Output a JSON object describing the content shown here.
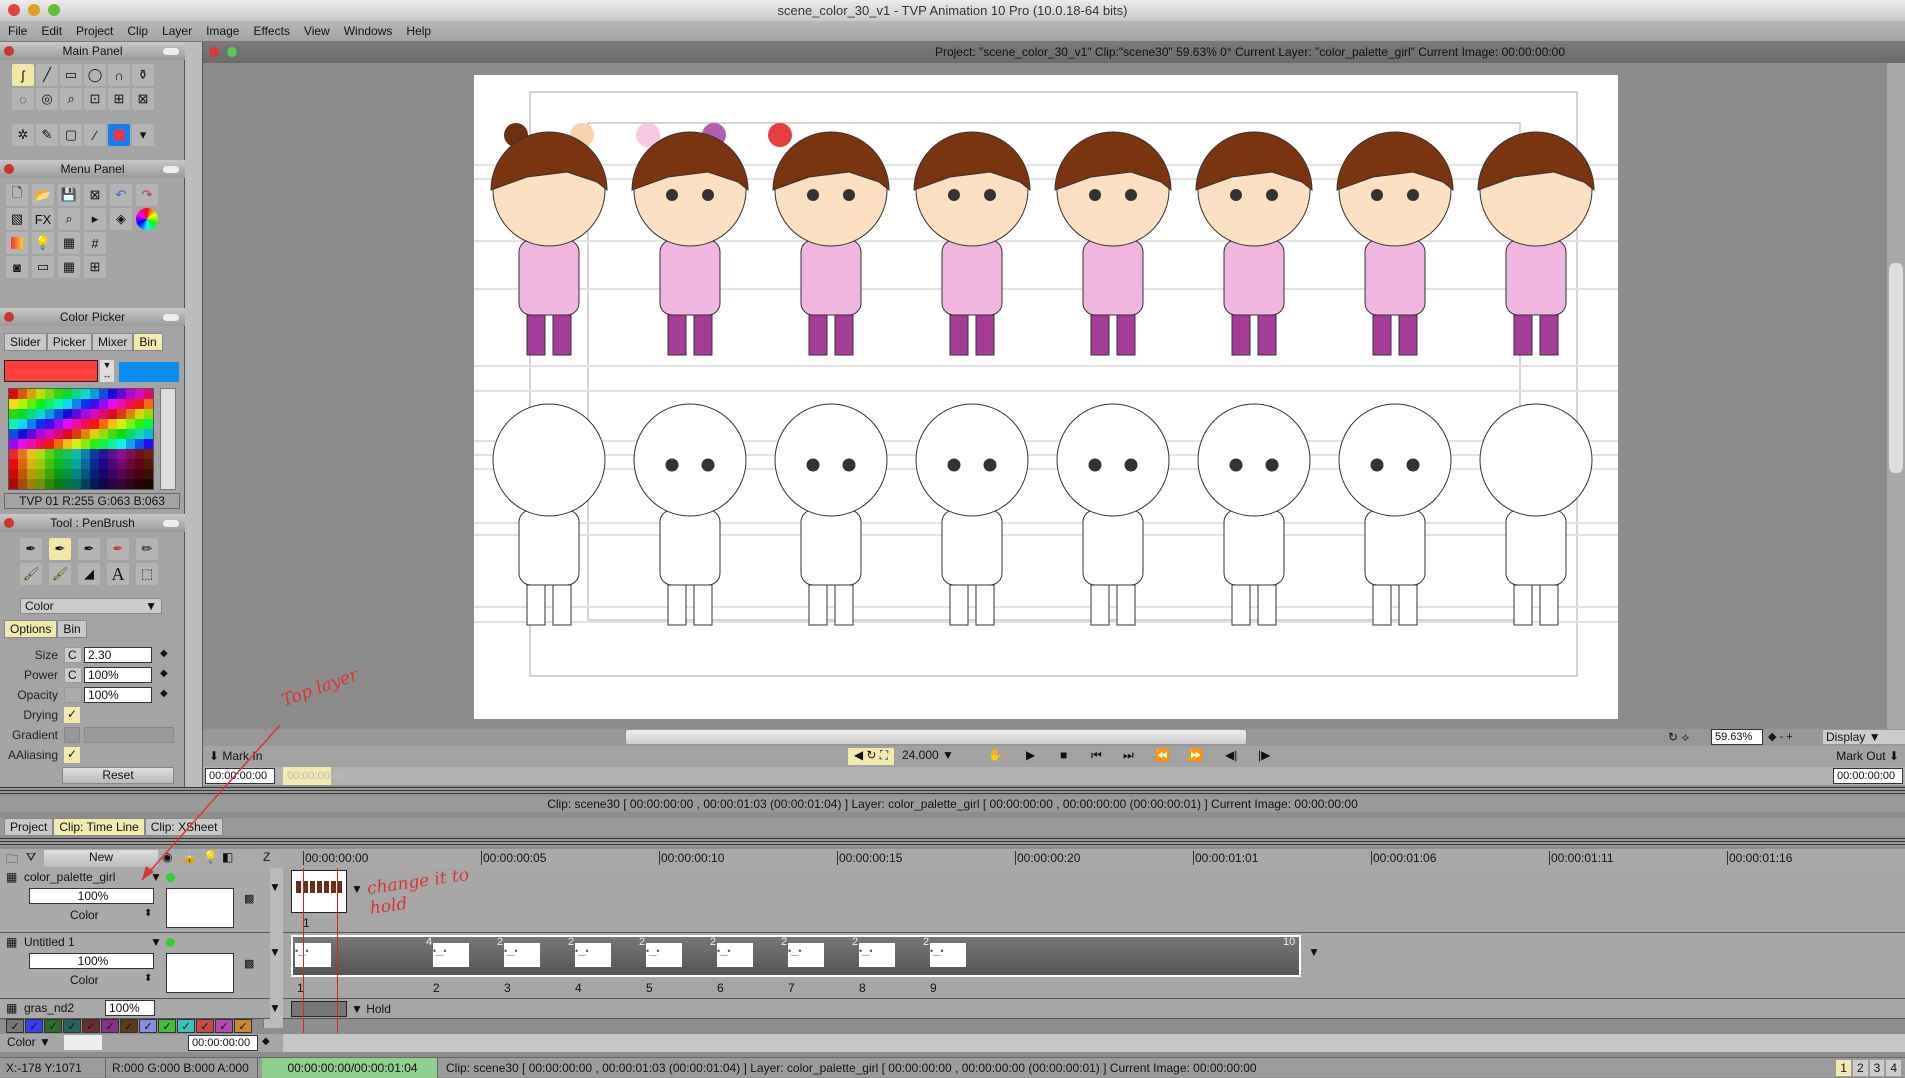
{
  "window": {
    "title": "scene_color_30_v1 - TVP Animation 10 Pro (10.0.18-64 bits)"
  },
  "menu": [
    "File",
    "Edit",
    "Project",
    "Clip",
    "Layer",
    "Image",
    "Effects",
    "View",
    "Windows",
    "Help"
  ],
  "main_panel": {
    "title": "Main Panel"
  },
  "menu_panel": {
    "title": "Menu Panel",
    "fx_label": "FX"
  },
  "color_picker": {
    "title": "Color Picker",
    "tabs": [
      "Slider",
      "Picker",
      "Mixer",
      "Bin"
    ],
    "active_tab": "Bin",
    "primary_color": "#ff3f3f",
    "secondary_color": "#0a8cf0",
    "info": "TVP 01 R:255 G:063 B:063"
  },
  "tool": {
    "title": "Tool : PenBrush",
    "mode": "Color",
    "tabs": [
      "Options",
      "Bin"
    ],
    "size_label": "Size",
    "size": "2.30",
    "power_label": "Power",
    "power": "100%",
    "opacity_label": "Opacity",
    "opacity": "100%",
    "drying_label": "Drying",
    "gradient_label": "Gradient",
    "aaliasing_label": "AAliasing",
    "c": "C",
    "reset": "Reset",
    "text_tool": "A"
  },
  "view": {
    "info": "Project: \"scene_color_30_v1\" Clip:\"scene30\"  59.63%   0°  Current Layer: \"color_palette_girl\"  Current Image: 00:00:00:00",
    "palette_swatches": [
      "#6b2f12",
      "#f9d3ad",
      "#f6c8e2",
      "#b35cb0",
      "#e83d3d"
    ]
  },
  "playback": {
    "mark_in": "Mark In",
    "mark_out": "Mark Out",
    "fps": "24.000",
    "zoom": "59.63%",
    "display": "Display",
    "start_tc": "00:00:00:00",
    "cursor_tc": "00:00:00:00",
    "end_tc": "00:00:00:00"
  },
  "clip_info": "Clip: scene30 [ 00:00:00:00 , 00:00:01:03  (00:00:01:04) ]     Layer: color_palette_girl [ 00:00:00:00 , 00:00:00:00  (00:00:00:01) ]   Current Image: 00:00:00:00",
  "bottom_tabs": [
    "Project",
    "Clip: Time Line",
    "Clip: XSheet"
  ],
  "timeline": {
    "new_button": "New",
    "z": "Z",
    "ruler": [
      "00:00:00:00",
      "00:00:00:05",
      "00:00:00:10",
      "00:00:00:15",
      "00:00:00:20",
      "00:00:01:01",
      "00:00:01:06",
      "00:00:01:11",
      "00:00:01:16"
    ],
    "layers": [
      {
        "name": "color_palette_girl",
        "opacity": "100%",
        "mode": "Color",
        "frames": [
          "1"
        ]
      },
      {
        "name": "Untitled 1",
        "opacity": "100%",
        "mode": "Color",
        "frames": [
          "1",
          "2",
          "3",
          "4",
          "5",
          "6",
          "7",
          "8",
          "9"
        ],
        "holds": [
          "4",
          "2",
          "2",
          "2",
          "2",
          "2",
          "2",
          "2",
          "10"
        ]
      },
      {
        "name": "gras_nd2",
        "opacity": "100%",
        "hold": "Hold"
      }
    ],
    "color_tags": [
      "#777777",
      "#3b3bf0",
      "#2f6a2f",
      "#2f6060",
      "#6a2d2d",
      "#8a2f8a",
      "#5a3a1a",
      "#8a8ae0",
      "#3fbf3f",
      "#3fbfbf",
      "#c84a4a",
      "#b04ab0",
      "#c8883a"
    ],
    "mode": "Color",
    "timecode": "00:00:00:00"
  },
  "annotations": {
    "top_layer": "Top layer",
    "change_hold": "change it to hold"
  },
  "status": {
    "coords": "X:-178  Y:1071",
    "rgba": "R:000 G:000 B:000 A:000",
    "time": "00:00:00:00/00:00:01:04",
    "info": "Clip: scene30 [ 00:00:00:00 , 00:00:01:03  (00:00:01:04) ]     Layer: color_palette_girl [ 00:00:00:00 , 00:00:00:00  (00:00:00:01) ]     Current Image: 00:00:00:00",
    "pages": [
      "1",
      "2",
      "3",
      "4"
    ]
  }
}
